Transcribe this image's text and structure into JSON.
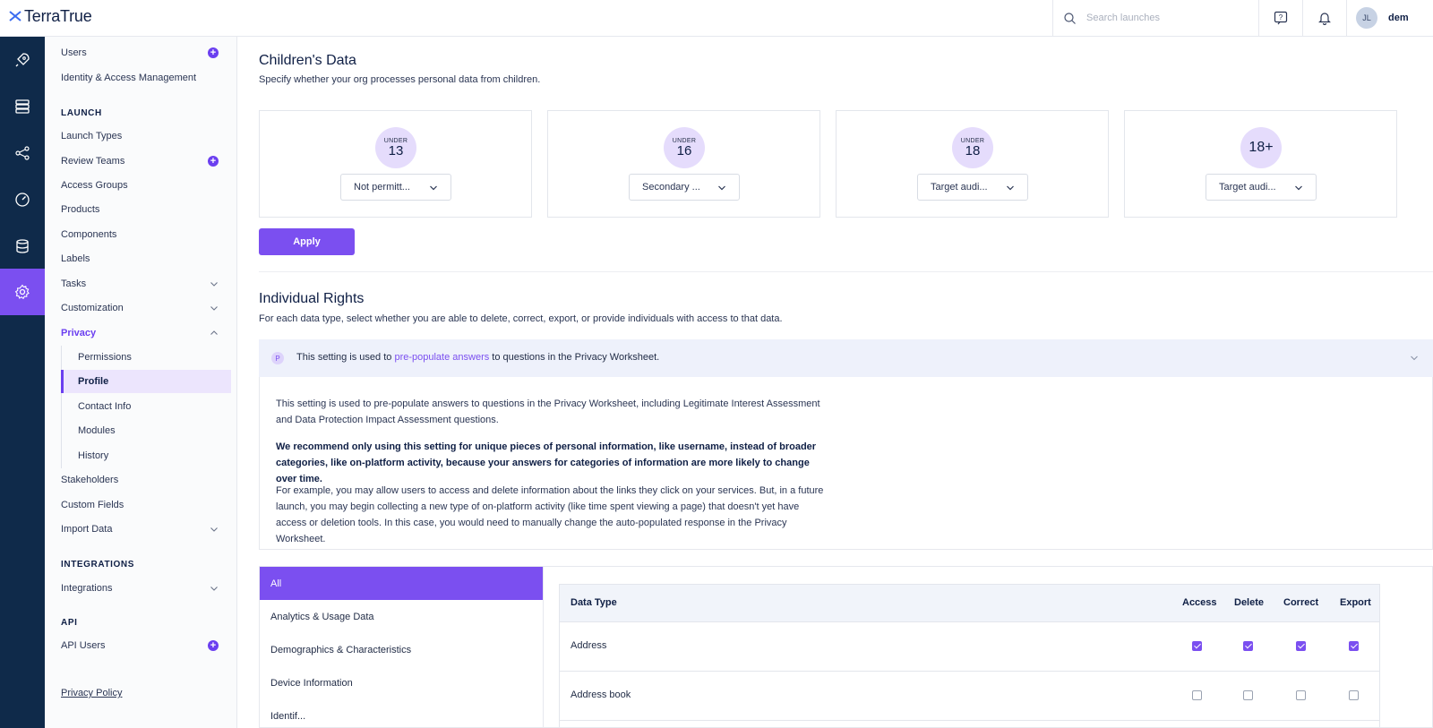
{
  "app": {
    "logo_text": "TerraTrue",
    "search_placeholder": "Search launches",
    "user_initials": "JL",
    "user_name": "dem"
  },
  "sidebar": {
    "top_items": [
      {
        "label": "Users"
      },
      {
        "label": "Identity & Access Management"
      }
    ],
    "launch_section": "LAUNCH",
    "launch_items": [
      {
        "label": "Launch Types"
      },
      {
        "label": "Review Teams"
      },
      {
        "label": "Access Groups"
      },
      {
        "label": "Products"
      },
      {
        "label": "Components"
      },
      {
        "label": "Labels"
      },
      {
        "label": "Tasks"
      },
      {
        "label": "Customization"
      },
      {
        "label": "Privacy"
      }
    ],
    "privacy_sub": [
      {
        "label": "Permissions"
      },
      {
        "label": "Profile"
      },
      {
        "label": "Contact Info"
      },
      {
        "label": "Modules"
      },
      {
        "label": "History"
      }
    ],
    "after_items": [
      {
        "label": "Stakeholders"
      },
      {
        "label": "Custom Fields"
      },
      {
        "label": "Import Data"
      }
    ],
    "integrations_section": "INTEGRATIONS",
    "integrations_items": [
      {
        "label": "Integrations"
      }
    ],
    "api_section": "API",
    "api_items": [
      {
        "label": "API Users"
      }
    ],
    "privacy_policy": "Privacy Policy"
  },
  "children": {
    "title": "Children's Data",
    "description": "Specify whether your org processes personal data from children.",
    "cards": [
      {
        "prefix": "UNDER",
        "age": "13",
        "value": "Not permitt..."
      },
      {
        "prefix": "UNDER",
        "age": "16",
        "value": "Secondary ..."
      },
      {
        "prefix": "UNDER",
        "age": "18",
        "value": "Target audi..."
      },
      {
        "prefix": "",
        "age": "18+",
        "value": "Target audi..."
      }
    ],
    "apply_label": "Apply"
  },
  "rights": {
    "title": "Individual Rights",
    "description": "For each data type, select whether you are able to delete, correct, export, or provide individuals with access to that data.",
    "info": {
      "badge": "P",
      "text_before": "This setting is used to ",
      "link": "pre-populate answers",
      "text_after": " to questions in the Privacy Worksheet.",
      "para1": "This setting is used to pre-populate answers to questions in the Privacy Worksheet, including Legitimate Interest Assessment and Data Protection Impact Assessment questions.",
      "para2": "We recommend only using this setting for unique pieces of personal information, like username, instead of broader categories, like on-platform activity, because your answers for categories of information are more likely to change over time.",
      "para3": "For example, you may allow users to access and delete information about the links they click on your services. But, in a future launch, you may begin collecting a new type of on-platform activity (like time spent viewing a page) that doesn't yet have access or deletion tools. In this case, you would need to manually change the auto-populated response in the Privacy Worksheet."
    },
    "categories": [
      {
        "label": "All"
      },
      {
        "label": "Analytics & Usage Data"
      },
      {
        "label": "Demographics & Characteristics"
      },
      {
        "label": "Device Information"
      },
      {
        "label": "Identif..."
      }
    ],
    "table": {
      "headers": {
        "type": "Data Type",
        "access": "Access",
        "delete": "Delete",
        "correct": "Correct",
        "export": "Export"
      },
      "rows": [
        {
          "name": "Address",
          "access": true,
          "delete": true,
          "correct": true,
          "export": true
        },
        {
          "name": "Address book",
          "access": false,
          "delete": false,
          "correct": false,
          "export": false
        }
      ]
    }
  },
  "colors": {
    "accent": "#7b4ff0",
    "rail": "#0f2a4a",
    "active_sub_bg": "#ece5fd"
  }
}
